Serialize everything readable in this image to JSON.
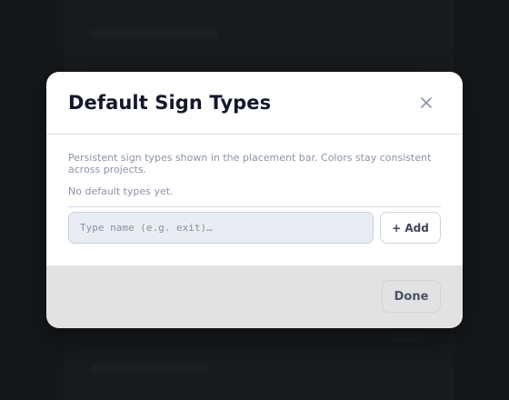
{
  "dialog": {
    "title": "Default Sign Types",
    "description": "Persistent sign types shown in the placement bar. Colors stay consistent across projects.",
    "empty_message": "No default types yet.",
    "close_icon": "close-icon",
    "input": {
      "value": "",
      "placeholder": "Type name (e.g. exit)…"
    },
    "add_label": "+ Add",
    "done_label": "Done"
  },
  "colors": {
    "backdrop": "#1d1f23",
    "title": "#14182a",
    "muted_text": "#8a93a6",
    "input_bg": "#e8edf4",
    "footer_bg": "#e2e2e3"
  }
}
